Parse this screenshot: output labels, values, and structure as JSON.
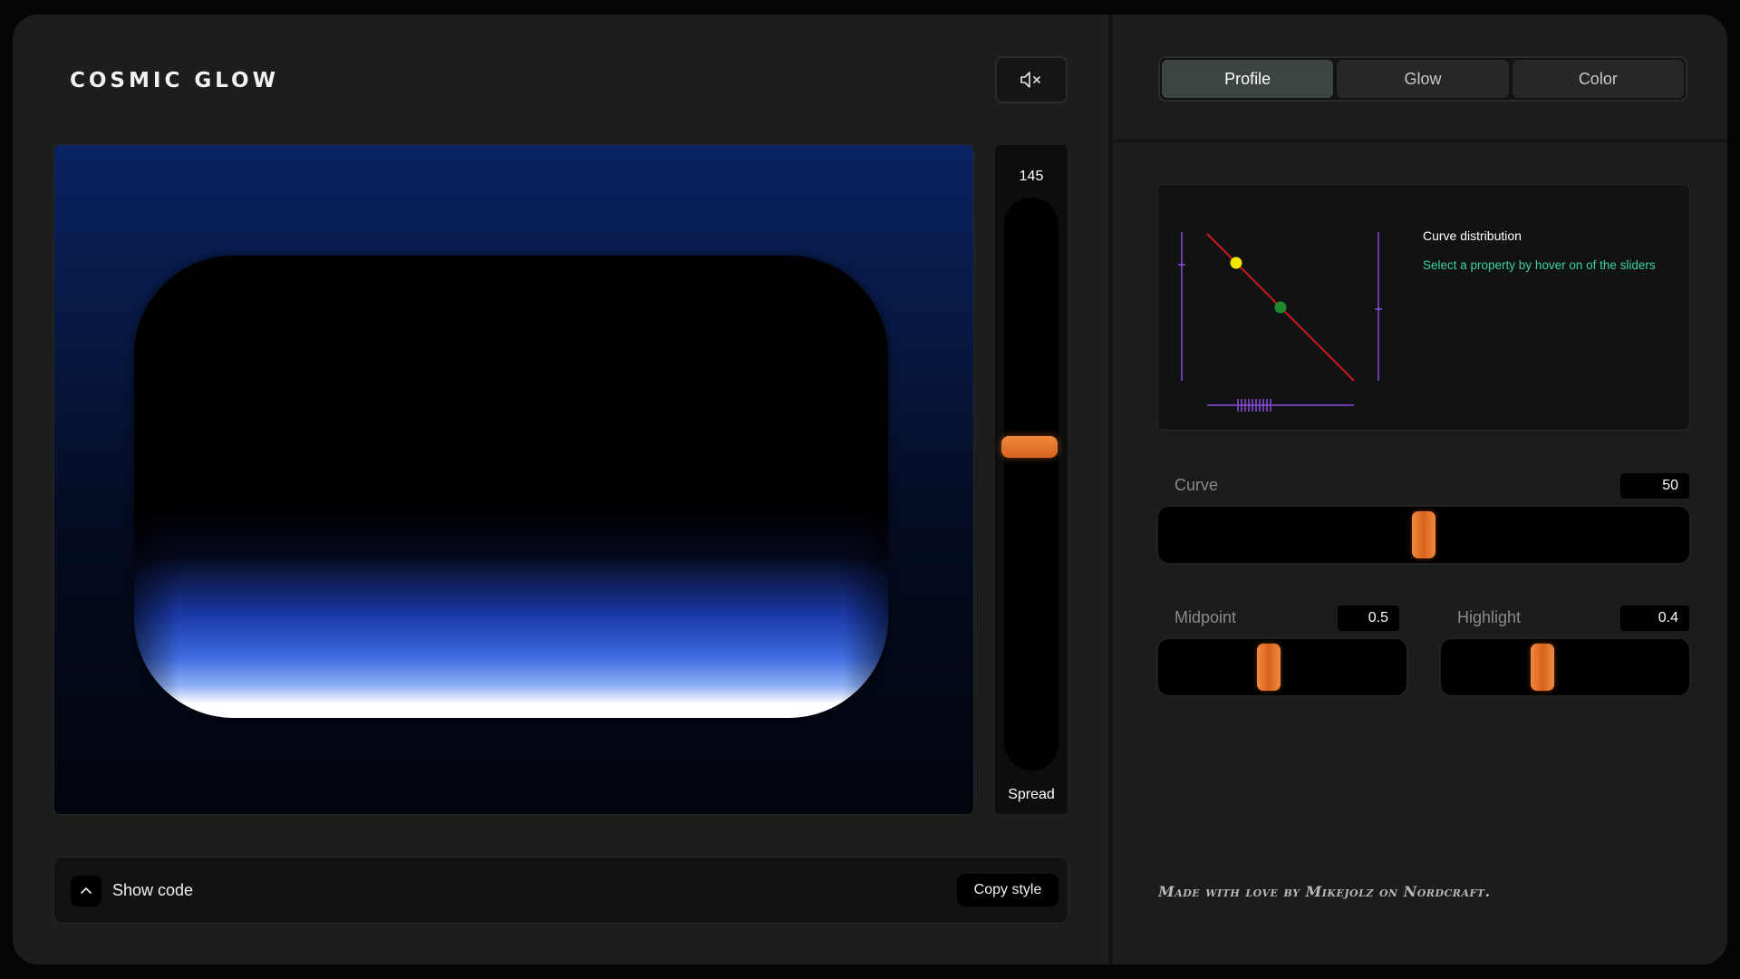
{
  "app": {
    "title": "COSMIC GLOW"
  },
  "toolbar": {
    "mute_icon": "speaker-muted-icon"
  },
  "preview": {
    "colors": {
      "background_top": "#0a2262",
      "glow_blue": "#3f6de0",
      "glow_edge": "#ffffff"
    }
  },
  "spread": {
    "value": "145",
    "label": "Spread",
    "level": 0.52
  },
  "code_bar": {
    "show_code_label": "Show code",
    "copy_label": "Copy style"
  },
  "tabs": [
    {
      "label": "Profile",
      "active": true
    },
    {
      "label": "Glow",
      "active": false
    },
    {
      "label": "Color",
      "active": false
    }
  ],
  "curve_card": {
    "title": "Curve distribution",
    "hint": "Select a property by hover on of the sliders",
    "colors": {
      "line": "#d01a1a",
      "point_a": "#f2e600",
      "point_b": "#1f8a2a",
      "axis": "#8a4de0"
    }
  },
  "sliders": {
    "curve": {
      "label": "Curve",
      "value": "50",
      "level": 0.5
    },
    "midpoint": {
      "label": "Midpoint",
      "value": "0.5",
      "level": 0.5
    },
    "highlight": {
      "label": "Highlight",
      "value": "0.4",
      "level": 0.4
    }
  },
  "footer": {
    "credit": "Made with love by Mikejolz on Nordcraft."
  },
  "accent_color": "#e8772e"
}
